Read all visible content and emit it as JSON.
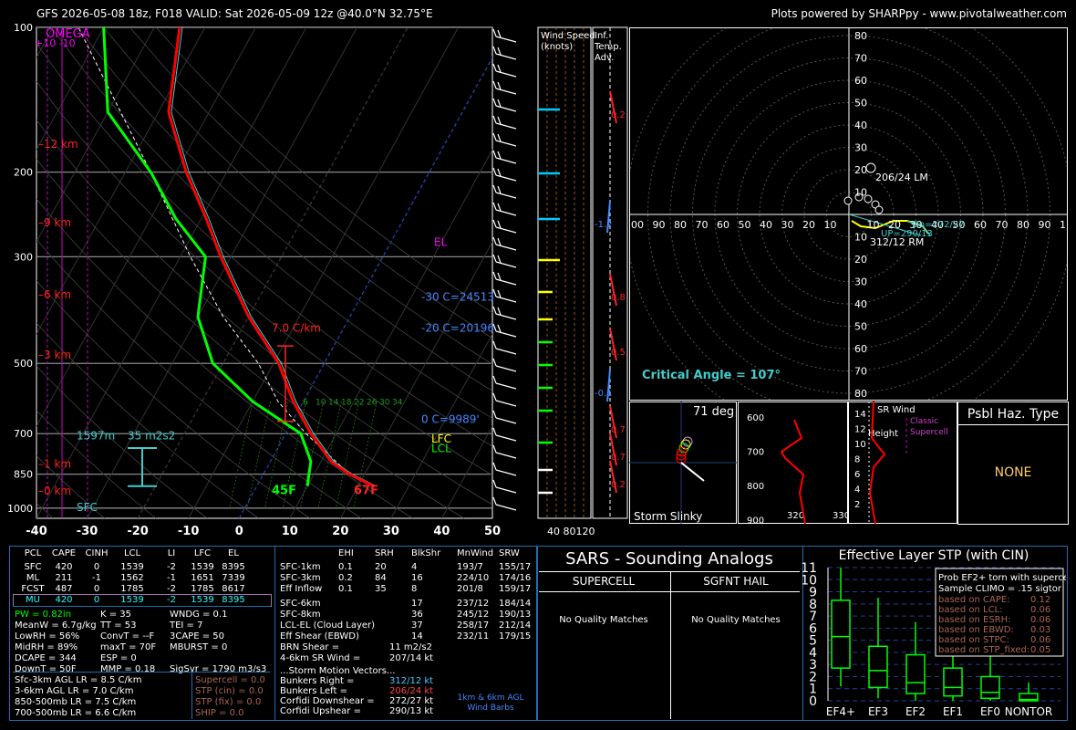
{
  "header": {
    "left": "GFS 2026-05-08 18z, F018  VALID: Sat 2026-05-09 12z @40.0°N 32.75°E",
    "right": "Plots powered by SHARPpy - www.pivotalweather.com"
  },
  "skewt": {
    "pressure_ticks": [
      "100",
      "200",
      "300",
      "500",
      "700",
      "850",
      "1000"
    ],
    "temp_ticks": [
      "-40",
      "-30",
      "-20",
      "-10",
      "0",
      "10",
      "20",
      "30",
      "40",
      "50"
    ],
    "height_labels": [
      "12 km",
      "9 km",
      "6 km",
      "3 km",
      "1 km",
      "0 km"
    ],
    "omega_label": "OMEGA",
    "omega_ticks": "+10  -10",
    "el_label": "EL",
    "lfc_label": "LFC",
    "lcl_label": "LCL",
    "lapse_label": "7.0 C/km",
    "m30_label": "-30 C=24513",
    "m20_label": "-20 C=20196",
    "zero_label": "0 C=9989'",
    "sfc_label": "SFC",
    "layer_depth": "1597m",
    "layer_srh": "35 m2s2",
    "sfc_temp": "67F",
    "sfc_dew": "45F",
    "mixing_ratios": [
      "6",
      "10",
      "14",
      "18",
      "22",
      "26",
      "30",
      "34"
    ],
    "wind_panel_title": "Wind Speed\n(knots)",
    "adv_panel_title": "Inf.\nTemp.\nAdv.",
    "wind_ticks": "40 80120",
    "adv_vals": [
      "0.2",
      "-1.2",
      "0.8",
      "0.5",
      "-0.1",
      "0.7",
      "0.7",
      "0.2"
    ]
  },
  "hodo": {
    "rings_top": [
      "80",
      "70",
      "60",
      "50",
      "40",
      "30",
      "20",
      "10"
    ],
    "rings_bot": [
      "10",
      "20",
      "30",
      "40",
      "50",
      "60",
      "70",
      "80"
    ],
    "rings_x": [
      "00",
      "90",
      "80",
      "70",
      "60",
      "50",
      "40",
      "30",
      "20",
      "10",
      "",
      "10",
      "20",
      "30",
      "40",
      "50",
      "60",
      "70",
      "80",
      "90",
      "1"
    ],
    "lm_label": "206/24 LM",
    "rm_label": "312/12 RM",
    "up_label": "UP=290/13",
    "down_label": "Dn=272/27",
    "critical_angle": "Critical Angle = 107°"
  },
  "slinky": {
    "title": "71 deg",
    "label": "Storm Slinky"
  },
  "theta": {
    "yticks": [
      "600",
      "700",
      "800",
      "900"
    ],
    "xticks": [
      "320",
      "330"
    ]
  },
  "srwind": {
    "title": "SR Wind",
    "sub": "Height",
    "yticks": [
      "14",
      "12",
      "10",
      "8",
      "6",
      "4",
      "2"
    ],
    "classic": "Classic\nSupercell"
  },
  "haz": {
    "title": "Psbl Haz. Type",
    "value": "NONE"
  },
  "params": {
    "header": [
      "PCL",
      "CAPE",
      "CINH",
      "LCL",
      "LI",
      "LFC",
      "EL"
    ],
    "rows": [
      [
        "SFC",
        "420",
        "0",
        "1539",
        "-2",
        "1539",
        "8395"
      ],
      [
        "ML",
        "211",
        "-1",
        "1562",
        "-1",
        "1651",
        "7339"
      ],
      [
        "FCST",
        "487",
        "0",
        "1785",
        "-2",
        "1785",
        "8617"
      ],
      [
        "MU",
        "420",
        "0",
        "1539",
        "-2",
        "1539",
        "8395"
      ]
    ],
    "col1": [
      "PW = 0.82in",
      "MeanW = 6.7g/kg",
      "LowRH = 56%",
      "MidRH = 89%",
      "DCAPE = 344",
      "DownT = 50F"
    ],
    "col2": [
      "K = 35",
      "TT = 53",
      "ConvT = --F",
      "maxT = 70F",
      "ESP = 0",
      "MMP = 0.18"
    ],
    "col3": [
      "WNDG = 0.1",
      "TEI = 7",
      "3CAPE = 50",
      "MBURST = 0",
      "",
      "SigSvr = 1790 m3/s3"
    ],
    "lapse": [
      "Sfc-3km AGL LR = 8.5 C/km",
      "3-6km AGL LR = 7.0 C/km",
      "850-500mb LR = 7.5 C/km",
      "700-500mb LR = 6.6 C/km"
    ],
    "comp": [
      "Supercell = 0.0",
      "STP (cin) = 0.0",
      "STP (fix) = 0.0",
      "SHIP = 0.0"
    ]
  },
  "kin": {
    "header": [
      "",
      "EHI",
      "SRH",
      "BlkShr",
      "MnWind",
      "SRW"
    ],
    "rows1": [
      [
        "SFC-1km",
        "0.1",
        "20",
        "4",
        "193/7",
        "155/17"
      ],
      [
        "SFC-3km",
        "0.2",
        "84",
        "16",
        "224/10",
        "174/16"
      ],
      [
        "Eff Inflow",
        "0.1",
        "35",
        "8",
        "201/8",
        "159/17"
      ]
    ],
    "rows2": [
      [
        "SFC-6km",
        "",
        "",
        "17",
        "237/12",
        "184/14"
      ],
      [
        "SFC-8km",
        "",
        "",
        "36",
        "245/12",
        "190/13"
      ],
      [
        "LCL-EL (Cloud Layer)",
        "",
        "",
        "37",
        "258/17",
        "212/14"
      ],
      [
        "Eff Shear (EBWD)",
        "",
        "",
        "14",
        "232/11",
        "179/15"
      ]
    ],
    "brn": [
      "BRN Shear =",
      "11 m2/s2"
    ],
    "srw46": [
      "4-6km SR Wind =",
      "207/14 kt"
    ],
    "smv": "...Storm Motion Vectors...",
    "vec": [
      [
        "Bunkers Right =",
        "312/12 kt"
      ],
      [
        "Bunkers Left =",
        "206/24 kt"
      ],
      [
        "Corfidi Downshear =",
        "272/27 kt"
      ],
      [
        "Corfidi Upshear =",
        "290/13 kt"
      ]
    ],
    "barb_note": "1km & 6km AGL\nWind Barbs"
  },
  "sars": {
    "title": "SARS - Sounding Analogs",
    "left": "SUPERCELL",
    "right": "SGFNT HAIL",
    "nomatch": "No Quality Matches"
  },
  "stp": {
    "title": "Effective Layer STP (with CIN)",
    "box_title": "Prob EF2+ torn with supercell",
    "box_sub": "Sample CLIMO = .15 sigtor",
    "box_rows": [
      [
        "based on CAPE:",
        "0.12"
      ],
      [
        "based on LCL:",
        "0.06"
      ],
      [
        "based on ESRH:",
        "0.06"
      ],
      [
        "based on EBWD:",
        "0.03"
      ],
      [
        "based on STPC:",
        "0.06"
      ],
      [
        "based on STP_fixed:",
        "0.05"
      ]
    ],
    "yticks": [
      "0",
      "1",
      "2",
      "3",
      "4",
      "5",
      "6",
      "7",
      "8",
      "9",
      "10",
      "11"
    ],
    "xcats": [
      "EF4+",
      "EF3",
      "EF2",
      "EF1",
      "EF0",
      "NONTOR"
    ]
  },
  "chart_data": {
    "type": "line",
    "title": "GFS 2026-05-08 18z, F018 VALID: Sat 2026-05-09 12z @40.0°N 32.75°E",
    "xlabel": "",
    "ylabel": "",
    "ylim": [
      1000,
      100
    ],
    "xlim": [
      -40,
      50
    ],
    "series": [
      {
        "values": [
          [
            900,
            23
          ],
          [
            850,
            17
          ],
          [
            800,
            12
          ],
          [
            700,
            5
          ],
          [
            600,
            -2
          ],
          [
            500,
            -9
          ],
          [
            400,
            -20
          ],
          [
            300,
            -32
          ],
          [
            250,
            -39
          ],
          [
            200,
            -48
          ],
          [
            150,
            -58
          ],
          [
            100,
            -65
          ]
        ]
      },
      {
        "values": [
          [
            900,
            10
          ],
          [
            850,
            9
          ],
          [
            800,
            8
          ],
          [
            700,
            3
          ],
          [
            600,
            -10
          ],
          [
            500,
            -22
          ],
          [
            400,
            -30
          ],
          [
            300,
            -35
          ],
          [
            250,
            -45
          ],
          [
            200,
            -55
          ],
          [
            150,
            -70
          ],
          [
            100,
            -80
          ]
        ]
      }
    ],
    "stp_boxes": [
      {
        "category": "EF4+",
        "min": 1.2,
        "q1": 2.7,
        "median": 5.3,
        "q3": 8.3,
        "max": 11.0
      },
      {
        "category": "EF3",
        "min": 0.2,
        "q1": 1.1,
        "median": 2.5,
        "q3": 4.5,
        "max": 8.5
      },
      {
        "category": "EF2",
        "min": 0.0,
        "q1": 0.6,
        "median": 1.5,
        "q3": 3.8,
        "max": 6.5
      },
      {
        "category": "EF1",
        "min": 0.0,
        "q1": 0.4,
        "median": 1.1,
        "q3": 2.7,
        "max": 4.5
      },
      {
        "category": "EF0",
        "min": 0.0,
        "q1": 0.2,
        "median": 0.7,
        "q3": 2.0,
        "max": 4.0
      },
      {
        "category": "NONTOR",
        "min": 0.0,
        "q1": 0.0,
        "median": 0.1,
        "q3": 0.6,
        "max": 1.5
      }
    ]
  }
}
